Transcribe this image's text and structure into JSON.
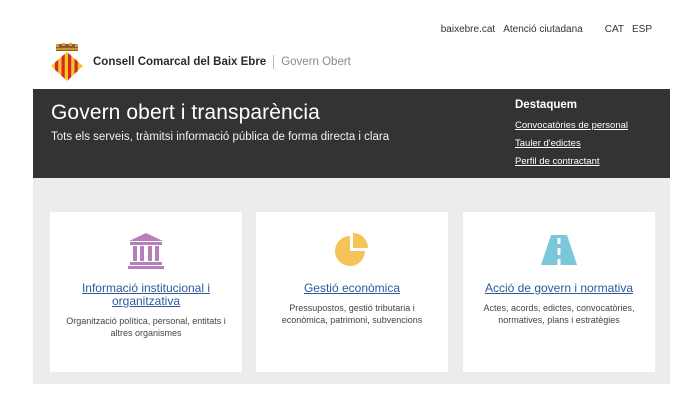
{
  "top_links": {
    "site": "baixebre.cat",
    "citizen": "Atenció ciutadana",
    "lang_cat": "CAT",
    "lang_esp": "ESP"
  },
  "brand": {
    "name": "Consell Comarcal del Baix Ebre",
    "section": "Govern Obert"
  },
  "hero": {
    "title": "Govern obert i transparència",
    "subtitle": "Tots els serveis, tràmitsi informació pública de forma directa i clara",
    "featured_title": "Destaquem",
    "featured_links": [
      "Convocatòries de personal",
      "Tauler d'edictes",
      "Perfil de contractant"
    ]
  },
  "cards": [
    {
      "title": "Informació institucional i organitzativa",
      "description": "Organització política, personal, entitats i altres organismes",
      "icon": "institution-icon",
      "color": "#b77fb9"
    },
    {
      "title": "Gestió econòmica",
      "description": "Pressupostos, gestió tributaria i econòmica, patrimoni, subvencions",
      "icon": "pie-chart-icon",
      "color": "#f5c35a"
    },
    {
      "title": "Acció de govern i normativa",
      "description": "Actes, acords, edictes, convocatòries, normatives, plans i estratègies",
      "icon": "road-icon",
      "color": "#79c7d9"
    }
  ]
}
